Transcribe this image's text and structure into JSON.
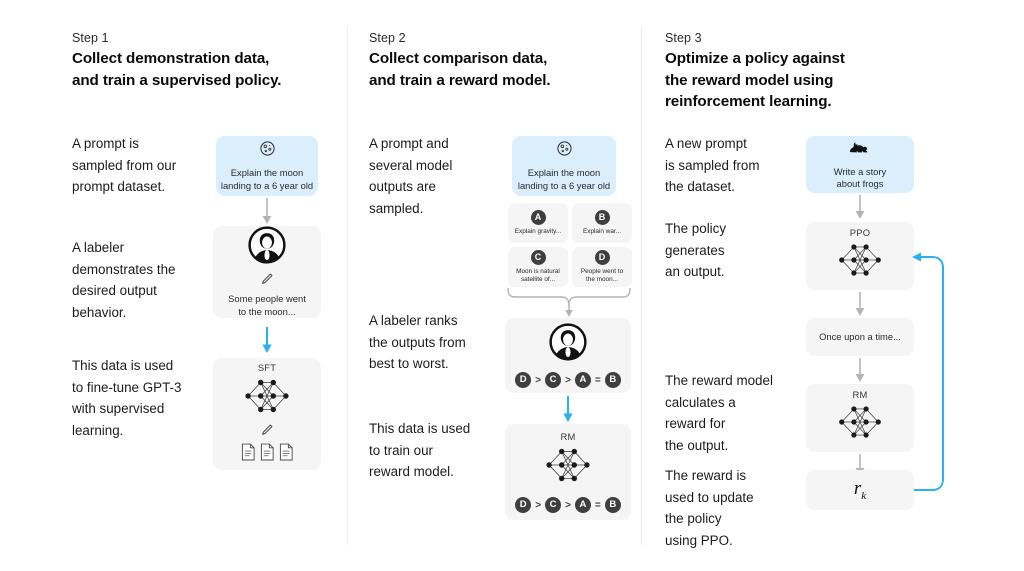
{
  "columns": [
    {
      "step_label": "Step 1",
      "title": "Collect demonstration data,\nand train a supervised policy.",
      "paragraphs": [
        "A prompt is\nsampled from our\nprompt dataset.",
        "A labeler\ndemonstrates the\ndesired output\nbehavior.",
        "This data is used\nto fine-tune GPT-3\nwith supervised\nlearning."
      ],
      "boxes": {
        "prompt": {
          "icon": "moon-icon",
          "caption": "Explain the moon\nlanding to a 6 year old"
        },
        "demo": {
          "icon": "labeler-avatar-icon",
          "caption": "Some people went\nto the moon..."
        },
        "sft": {
          "title": "SFT",
          "icon": "neural-network-icon"
        }
      }
    },
    {
      "step_label": "Step 2",
      "title": "Collect comparison data,\nand train a reward model.",
      "paragraphs": [
        "A prompt and\nseveral model\noutputs are\nsampled.",
        "A labeler ranks\nthe outputs from\nbest to worst.",
        "This data is used\nto train our\nreward model."
      ],
      "boxes": {
        "prompt": {
          "icon": "moon-icon",
          "caption": "Explain the moon\nlanding to a 6 year old"
        },
        "outputs": [
          {
            "letter": "A",
            "text": "Explain gravity..."
          },
          {
            "letter": "B",
            "text": "Explain war..."
          },
          {
            "letter": "C",
            "text": "Moon is natural\nsatellite of..."
          },
          {
            "letter": "D",
            "text": "People went to\nthe moon..."
          }
        ],
        "ranking": {
          "icon": "labeler-avatar-icon",
          "items": [
            "D",
            "C",
            "A",
            "B"
          ],
          "operators": [
            ">",
            ">",
            "="
          ]
        },
        "rm": {
          "title": "RM",
          "icon": "neural-network-icon",
          "items": [
            "D",
            "C",
            "A",
            "B"
          ],
          "operators": [
            ">",
            ">",
            "="
          ]
        }
      }
    },
    {
      "step_label": "Step 3",
      "title": "Optimize a policy against\nthe reward model using\nreinforcement learning.",
      "paragraphs": [
        "A new prompt\nis sampled from\nthe dataset.",
        "The policy\ngenerates\nan output.",
        "The reward model\ncalculates a\nreward for\nthe output.",
        "The reward is\nused to update\nthe policy\nusing PPO."
      ],
      "boxes": {
        "prompt": {
          "icon": "frog-icon",
          "caption": "Write a story\nabout frogs"
        },
        "ppo": {
          "title": "PPO",
          "icon": "neural-network-icon"
        },
        "output": {
          "caption": "Once upon a time..."
        },
        "rm": {
          "title": "RM",
          "icon": "neural-network-icon"
        },
        "reward": {
          "symbol": "r",
          "subscript": "k"
        }
      }
    }
  ],
  "colors": {
    "prompt_box_bg": "#daeefb",
    "grey_box_bg": "#f5f5f5",
    "blue_arrow": "#29b0f0",
    "grey_arrow": "#b4b4b4",
    "chip_bg": "#3f3f3f",
    "divider": "#ebebeb"
  }
}
